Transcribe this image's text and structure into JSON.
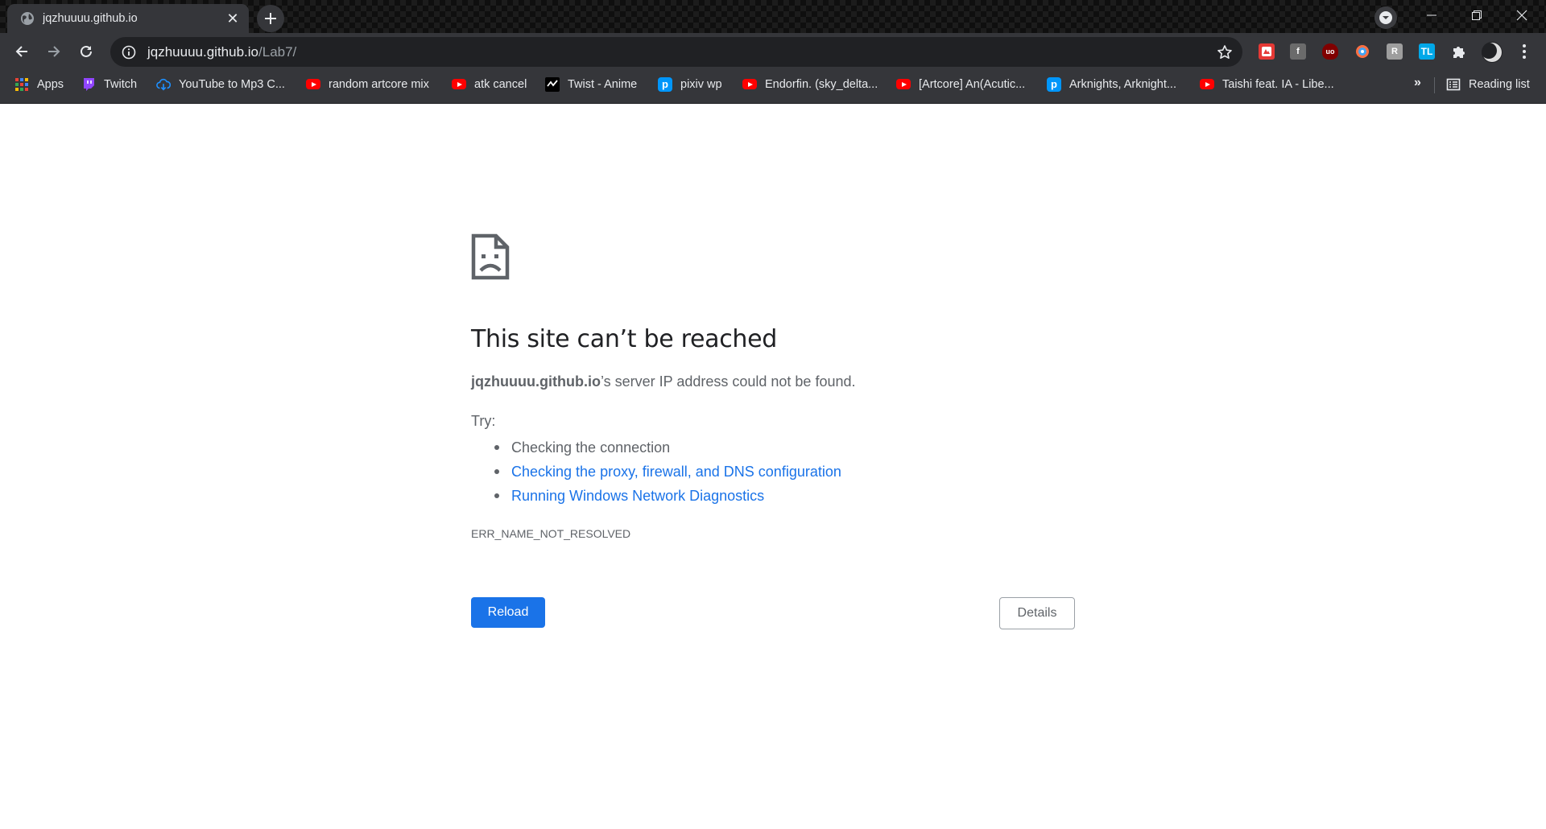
{
  "browser": {
    "tab": {
      "title": "jqzhuuuu.github.io",
      "close_glyph": "✕",
      "favicon": "globe-icon"
    },
    "omnibox": {
      "host": "jqzhuuuu.github.io",
      "path": "/Lab7/"
    },
    "bookmarks": [
      {
        "label": "Apps",
        "icon": "apps-grid-icon"
      },
      {
        "label": "Twitch",
        "icon": "twitch-icon"
      },
      {
        "label": "YouTube to Mp3 C...",
        "icon": "cloud-download-icon"
      },
      {
        "label": "random artcore mix",
        "icon": "youtube-icon"
      },
      {
        "label": "atk cancel",
        "icon": "youtube-icon"
      },
      {
        "label": "Twist - Anime",
        "icon": "twist-icon"
      },
      {
        "label": "pixiv wp",
        "icon": "pixiv-icon"
      },
      {
        "label": "Endorfin. (sky_delta...",
        "icon": "youtube-icon"
      },
      {
        "label": "[Artcore] An(Acutic...",
        "icon": "youtube-icon"
      },
      {
        "label": "Arknights, Arknight...",
        "icon": "pixiv-icon"
      },
      {
        "label": "Taishi feat. IA - Libe...",
        "icon": "youtube-icon"
      }
    ],
    "bookmarks_more": "»",
    "reading_list": "Reading list",
    "extensions": [
      {
        "name": "pdf-extension-icon",
        "text": "",
        "color": "#e53935"
      },
      {
        "name": "facebook-extension-icon",
        "text": "f",
        "color": "#6b6b6b"
      },
      {
        "name": "ublock-origin-icon",
        "text": "uo",
        "color": "#800000"
      },
      {
        "name": "colorful-extension-icon",
        "text": "",
        "color": "#ff7043"
      },
      {
        "name": "r-extension-icon",
        "text": "R",
        "color": "#9e9e9e"
      },
      {
        "name": "tl-extension-icon",
        "text": "TL",
        "color": "#00a8e8"
      }
    ]
  },
  "error_page": {
    "title": "This site can’t be reached",
    "host": "jqzhuuuu.github.io",
    "message_suffix": "’s server IP address could not be found.",
    "try_label": "Try:",
    "suggestions": [
      {
        "text": "Checking the connection",
        "link": false
      },
      {
        "text": "Checking the proxy, firewall, and DNS configuration",
        "link": true
      },
      {
        "text": "Running Windows Network Diagnostics",
        "link": true
      }
    ],
    "error_code": "ERR_NAME_NOT_RESOLVED",
    "reload_label": "Reload",
    "details_label": "Details"
  }
}
